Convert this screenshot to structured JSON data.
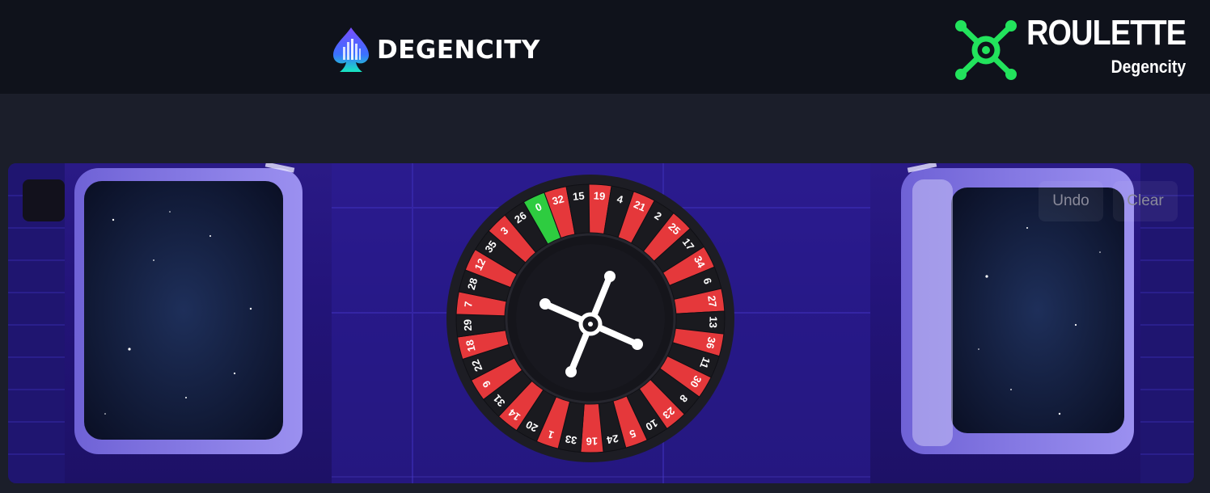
{
  "header": {
    "brand_name": "DEGENCITY",
    "game_title": "ROULETTE",
    "game_subtitle": "Degencity"
  },
  "controls": {
    "undo_label": "Undo",
    "clear_label": "Clear"
  },
  "wheel": {
    "numbers": [
      "0",
      "32",
      "15",
      "19",
      "4",
      "21",
      "2",
      "25",
      "17",
      "34",
      "6",
      "27",
      "13",
      "36",
      "11",
      "30",
      "8",
      "23",
      "10",
      "5",
      "24",
      "16",
      "33",
      "1",
      "20",
      "14",
      "31",
      "9",
      "22",
      "18",
      "29",
      "7",
      "28",
      "12",
      "35",
      "3",
      "26"
    ],
    "colors": {
      "red": "#e5383b",
      "black": "#1a1a1f",
      "green": "#2ecc40",
      "rim": "#1d1d24",
      "accent": "#00e85a"
    }
  }
}
